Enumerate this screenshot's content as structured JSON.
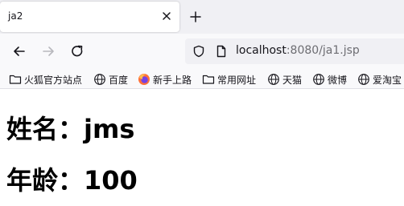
{
  "browser": {
    "tab": {
      "title": "ja2"
    },
    "address": {
      "host": "localhost",
      "path": ":8080/ja1.jsp"
    },
    "bookmarks": [
      {
        "label": "火狐官方站点",
        "icon": "folder-icon"
      },
      {
        "label": "百度",
        "icon": "globe-icon"
      },
      {
        "label": "新手上路",
        "icon": "firefox-icon"
      },
      {
        "label": "常用网址",
        "icon": "folder-icon"
      },
      {
        "label": "天猫",
        "icon": "globe-icon"
      },
      {
        "label": "微博",
        "icon": "globe-icon"
      },
      {
        "label": "爱淘宝",
        "icon": "globe-icon"
      }
    ]
  },
  "page": {
    "name_line": "姓名：jms",
    "age_line": "年龄：100"
  }
}
